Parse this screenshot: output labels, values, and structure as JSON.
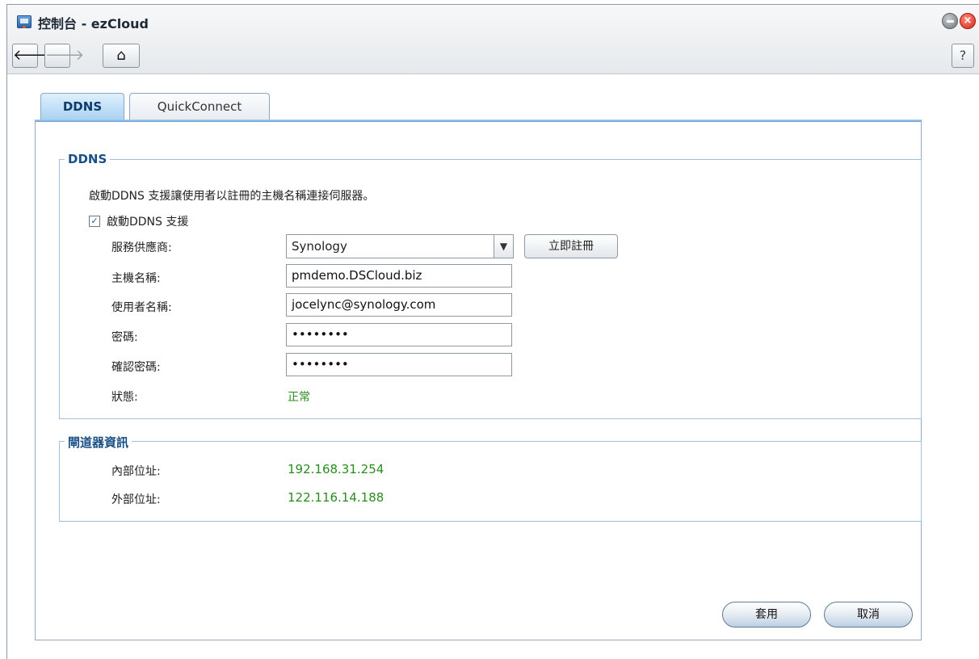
{
  "window": {
    "title": "控制台 - ezCloud"
  },
  "toolbar": {
    "back": "🡐",
    "forward": "🡒",
    "home": "⌂",
    "help": "?"
  },
  "tabs": [
    {
      "label": "DDNS",
      "active": true
    },
    {
      "label": "QuickConnect",
      "active": false
    }
  ],
  "ddns": {
    "legend": "DDNS",
    "description": "啟動DDNS 支援讓使用者以註冊的主機名稱連接伺服器。",
    "enable_label": "啟動DDNS 支援",
    "enable_checked": true,
    "provider_label": "服務供應商:",
    "provider_value": "Synology",
    "register_button": "立即註冊",
    "hostname_label": "主機名稱:",
    "hostname_value": "pmdemo.DSCloud.biz",
    "username_label": "使用者名稱:",
    "username_value": "jocelync@synology.com",
    "password_label": "密碼:",
    "password_value": "••••••••",
    "confirm_label": "確認密碼:",
    "confirm_value": "••••••••",
    "status_label": "狀態:",
    "status_value": "正常"
  },
  "gateway": {
    "legend": "閘道器資訊",
    "internal_label": "內部位址:",
    "internal_value": "192.168.31.254",
    "external_label": "外部位址:",
    "external_value": "122.116.14.188"
  },
  "buttons": {
    "apply": "套用",
    "cancel": "取消"
  },
  "colors": {
    "status_green": "#2a8c1e",
    "legend_blue": "#184f86",
    "tab_active": "#a9d2f2"
  }
}
